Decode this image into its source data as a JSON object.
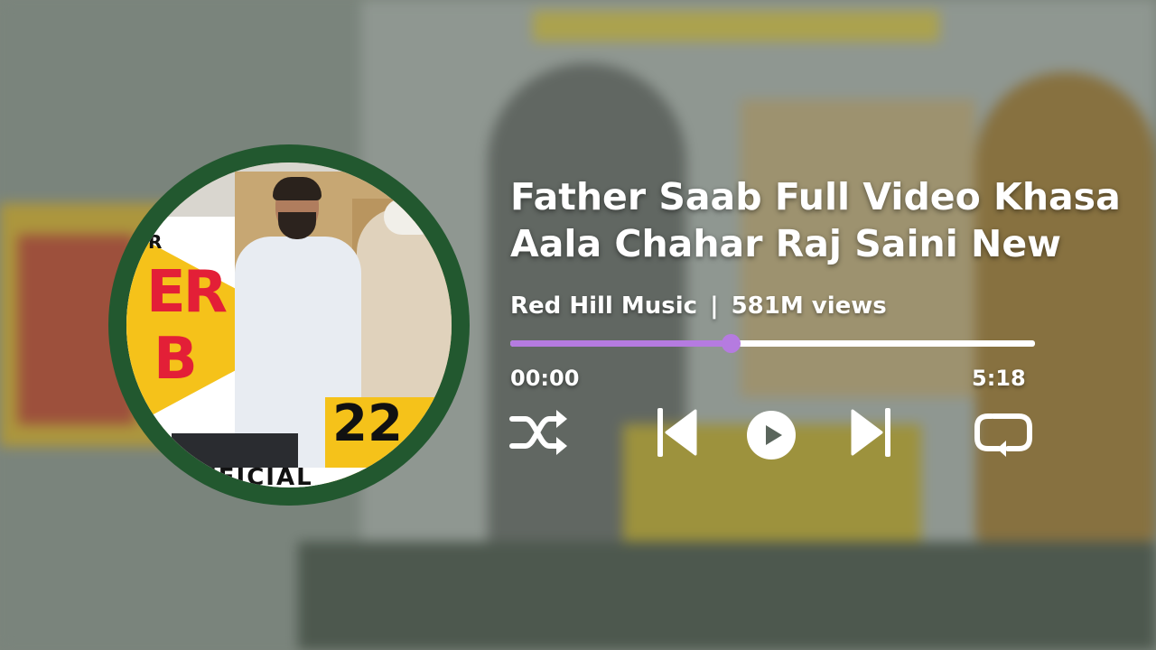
{
  "track": {
    "title": "Father Saab Full Video Khasa Aala Chahar Raj Saini New",
    "artist": "Red Hill Music",
    "separator": "|",
    "views": "581M views"
  },
  "progress": {
    "current_time": "00:00",
    "duration": "5:18",
    "fraction": 0.42
  },
  "album_art": {
    "text_r": "R",
    "text_line1": "ER",
    "text_line2": "B",
    "text_num": "22",
    "text_official": "FFICIAL"
  },
  "controls": {
    "shuffle_icon": "shuffle-icon",
    "prev_icon": "skip-previous-icon",
    "play_icon": "play-icon",
    "next_icon": "skip-next-icon",
    "repeat_icon": "repeat-icon"
  },
  "colors": {
    "accent": "#b57be0",
    "art_ring": "#22582f",
    "text": "#ffffff"
  }
}
